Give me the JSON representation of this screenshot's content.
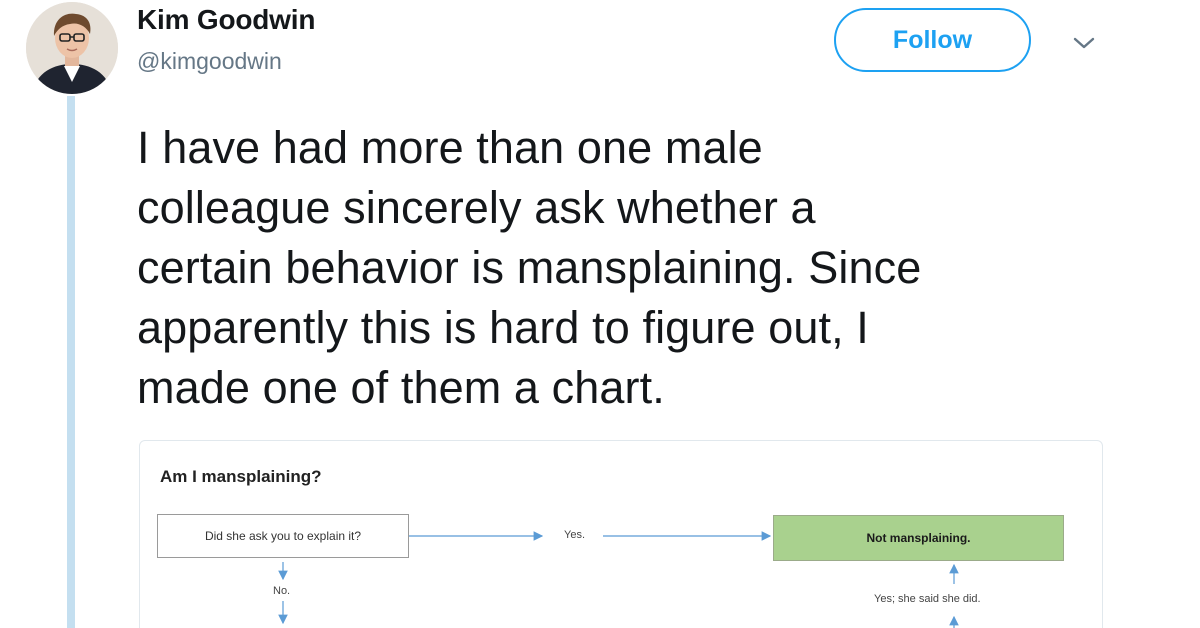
{
  "user": {
    "display_name": "Kim Goodwin",
    "handle": "@kimgoodwin"
  },
  "actions": {
    "follow_label": "Follow"
  },
  "icons": {
    "caret": "chevron-down-icon",
    "avatar": "user-avatar"
  },
  "tweet": {
    "text": "I have had more than one male\ncolleague sincerely ask whether a\ncertain behavior is mansplaining. Since\napparently this is hard to figure out, I\nmade one of them a chart."
  },
  "flowchart": {
    "title": "Am I mansplaining?",
    "question": "Did she ask you to explain it?",
    "yes_label": "Yes.",
    "result": "Not mansplaining.",
    "no_label": "No.",
    "yes_said_label": "Yes; she said she did."
  },
  "colors": {
    "accent": "#1da1f2",
    "thread_line": "#c4dff0",
    "result_fill": "#a9d18e",
    "arrow": "#5b9bd5"
  }
}
